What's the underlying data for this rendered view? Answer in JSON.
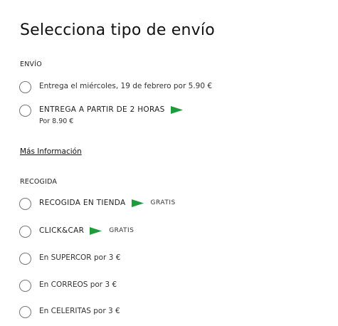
{
  "page": {
    "title": "Selecciona tipo de envío"
  },
  "shipping": {
    "heading": "ENVÍO",
    "options": [
      {
        "label": "Entrega el miércoles, 19 de febrero por 5.90 €"
      },
      {
        "label": "ENTREGA A PARTIR DE 2 HORAS",
        "price": "Por 8.90 €",
        "icon": "green-flag-icon"
      }
    ],
    "more_info": "Más Información"
  },
  "pickup": {
    "heading": "RECOGIDA",
    "options": [
      {
        "label": "RECOGIDA EN TIENDA",
        "badge": "GRATIS",
        "icon": "green-flag-icon"
      },
      {
        "label": "CLICK&CAR",
        "badge": "GRATIS",
        "icon": "green-flag-icon"
      },
      {
        "label": "En SUPERCOR por 3 €"
      },
      {
        "label": "En CORREOS por 3 €"
      },
      {
        "label": "En CELERITAS por 3 €"
      }
    ]
  },
  "colors": {
    "flag": "#1e9b3a",
    "radio_border": "#777777",
    "text": "#1a1a1a"
  }
}
